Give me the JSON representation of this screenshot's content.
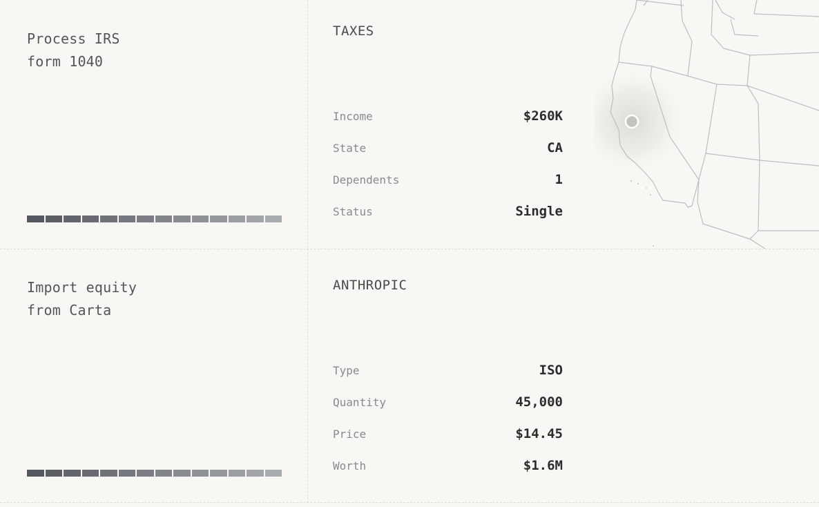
{
  "colors": {
    "background": "#f8f7f3",
    "separator": "#dedcd6",
    "progress_dark": "#55585e",
    "progress_light": "#a8abb0",
    "map_lines": "#bdbdbd",
    "marker": "#c4c3bd"
  },
  "tasks": [
    {
      "title": "Process IRS\nform 1040",
      "section": "TAXES",
      "progress_segments": 14,
      "fields": [
        {
          "label": "Income",
          "value": "$260K"
        },
        {
          "label": "State",
          "value": "CA"
        },
        {
          "label": "Dependents",
          "value": "1"
        },
        {
          "label": "Status",
          "value": "Single"
        }
      ]
    },
    {
      "title": "Import equity\nfrom Carta",
      "section": "ANTHROPIC",
      "progress_segments": 14,
      "fields": [
        {
          "label": "Type",
          "value": "ISO"
        },
        {
          "label": "Quantity",
          "value": "45,000"
        },
        {
          "label": "Price",
          "value": "$14.45"
        },
        {
          "label": "Worth",
          "value": "$1.6M"
        }
      ]
    }
  ],
  "map": {
    "icon": "us-west-states-map",
    "marker_icon": "location-dot-icon"
  }
}
